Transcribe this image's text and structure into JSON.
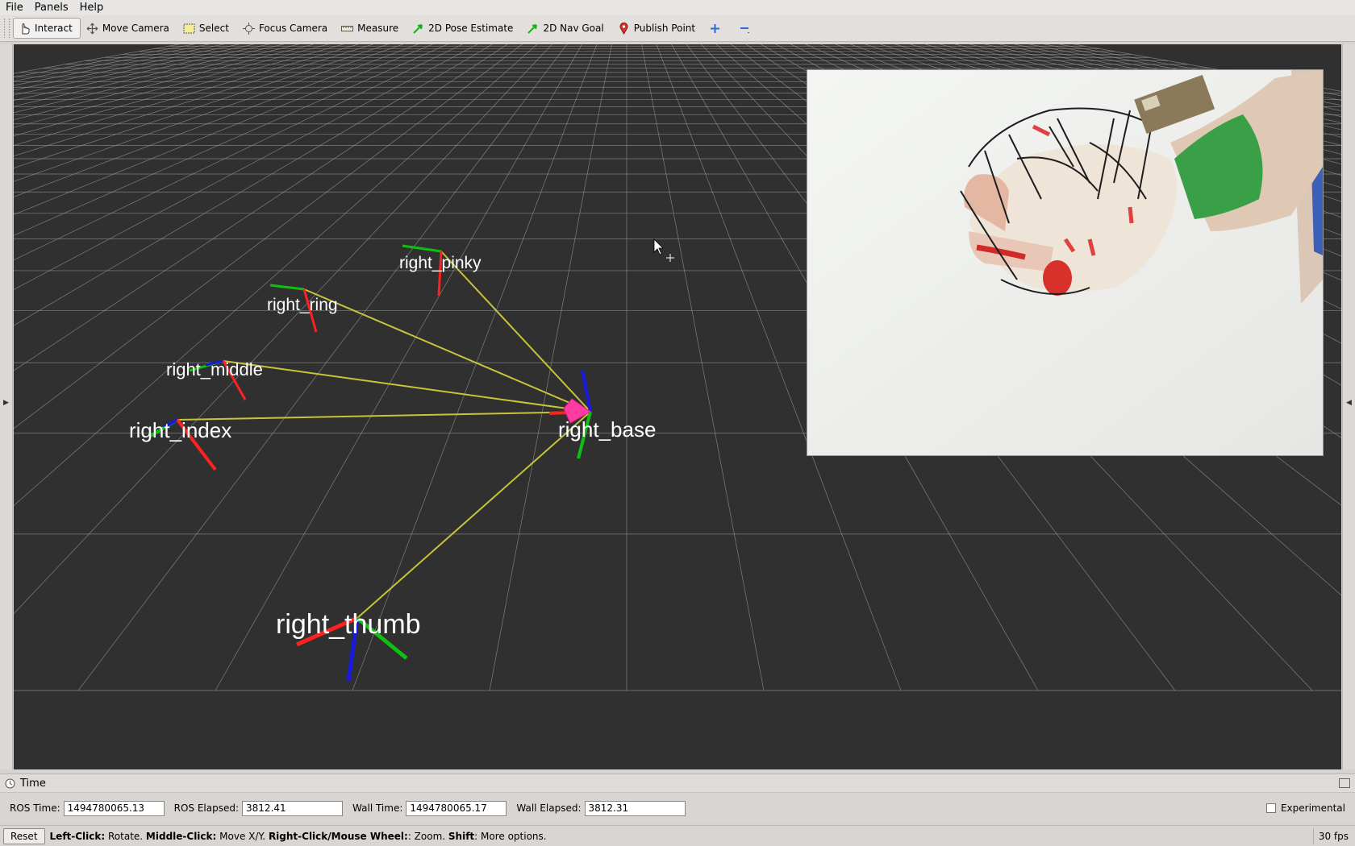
{
  "menu": [
    "File",
    "Panels",
    "Help"
  ],
  "toolbar": {
    "interact": "Interact",
    "move_camera": "Move Camera",
    "select": "Select",
    "focus_camera": "Focus Camera",
    "measure": "Measure",
    "pose_estimate": "2D Pose Estimate",
    "nav_goal": "2D Nav Goal",
    "publish_point": "Publish Point"
  },
  "frames": {
    "pinky": "right_pinky",
    "ring": "right_ring",
    "middle": "right_middle",
    "index": "right_index",
    "base": "right_base",
    "thumb": "right_thumb"
  },
  "colors": {
    "viewport_bg": "#303030",
    "grid": "#a0a0a0",
    "link": "#c8c43a",
    "x_axis": "#ff2020",
    "y_axis": "#10d010",
    "z_axis": "#1818e0",
    "marker": "#ff3aa0"
  },
  "time_panel": {
    "title": "Time",
    "ros_time_label": "ROS Time:",
    "ros_time": "1494780065.13",
    "ros_elapsed_label": "ROS Elapsed:",
    "ros_elapsed": "3812.41",
    "wall_time_label": "Wall Time:",
    "wall_time": "1494780065.17",
    "wall_elapsed_label": "Wall Elapsed:",
    "wall_elapsed": "3812.31",
    "experimental": "Experimental"
  },
  "status": {
    "reset": "Reset",
    "left_click": "Left-Click:",
    "left_click_desc": " Rotate. ",
    "middle_click": "Middle-Click:",
    "middle_click_desc": " Move X/Y. ",
    "right_click": "Right-Click/Mouse Wheel:",
    "right_click_desc": ": Zoom. ",
    "shift": "Shift",
    "shift_desc": ": More options.",
    "fps": "30 fps"
  }
}
